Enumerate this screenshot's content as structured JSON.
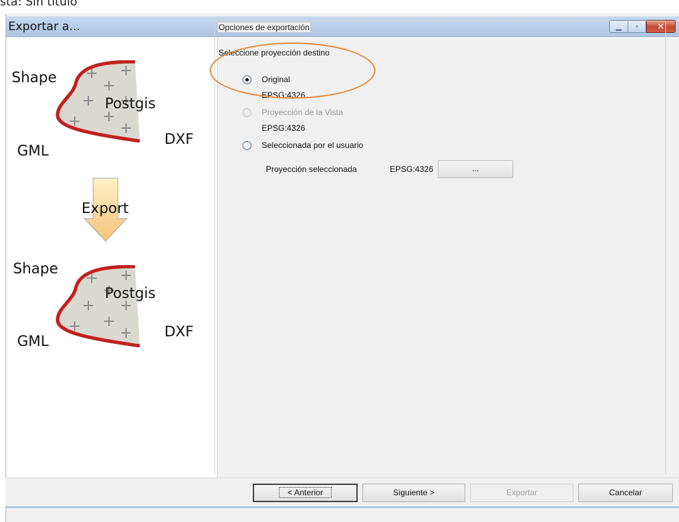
{
  "background_window": {
    "title": "sta: Sin título"
  },
  "window": {
    "title": "Exportar a...",
    "controls": {
      "minimize_icon": "minimize-icon",
      "maximize_icon": "maximize-icon",
      "close_icon": "close-icon"
    }
  },
  "illustration": {
    "top": {
      "shape": "Shape",
      "postgis": "Postgis",
      "gml": "GML",
      "dxf": "DXF"
    },
    "arrow_label": "Export",
    "bottom": {
      "shape": "Shape",
      "postgis": "Postgis",
      "gml": "GML",
      "dxf": "DXF"
    },
    "colors": {
      "outline": "#c0211f",
      "fill": "#d9d9d1",
      "cross": "#8c8c8c",
      "arrow_top": "#fff2c6",
      "arrow_bottom": "#f4c27a"
    }
  },
  "options": {
    "group_title": "Opciones de exportación",
    "section_label": "Seleccione proyección destino",
    "radios": [
      {
        "label": "Original",
        "sublabel": "EPSG:4326",
        "checked": true,
        "enabled": true
      },
      {
        "label": "Proyección de la Vista",
        "sublabel": "EPSG:4326",
        "checked": false,
        "enabled": false
      },
      {
        "label": "Seleccionada por el usuario",
        "sublabel": "",
        "checked": false,
        "enabled": true
      }
    ],
    "selected_projection_label": "Proyección seleccionada",
    "selected_projection_value": "EPSG:4326",
    "browse_button": "...",
    "highlight_color": "#e38a3c"
  },
  "footer": {
    "previous": "< Anterior",
    "next": "Siguiente >",
    "export": "Exportar",
    "cancel": "Cancelar"
  }
}
